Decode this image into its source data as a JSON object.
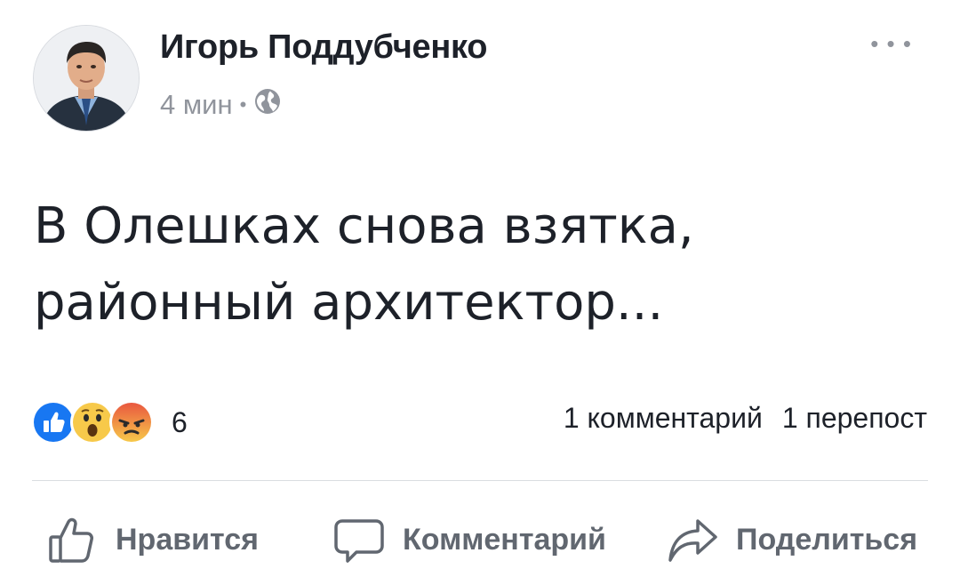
{
  "post": {
    "author": "Игорь Поддубченко",
    "time": "4 мин",
    "separator": "•",
    "more_label": "• • •",
    "text_line1": "В Олешках снова взятка,",
    "text_line2": "районный архитектор...",
    "reactions_count": "6",
    "comments_label": "1 комментарий",
    "shares_label": "1 перепост"
  },
  "icons": {
    "audience": "globe-icon",
    "reactions": [
      "like-icon",
      "wow-icon",
      "angry-icon"
    ],
    "actions": [
      "thumbs-up-icon",
      "comment-icon",
      "share-icon"
    ]
  },
  "colors": {
    "like_blue": "#1877f2",
    "wow_yellow": "#f7c94a",
    "angry_red": "#e9573f",
    "action_gray": "#616770",
    "meta_gray": "#90949c"
  },
  "actions": {
    "like": "Нравится",
    "comment": "Комментарий",
    "share": "Поделиться"
  }
}
